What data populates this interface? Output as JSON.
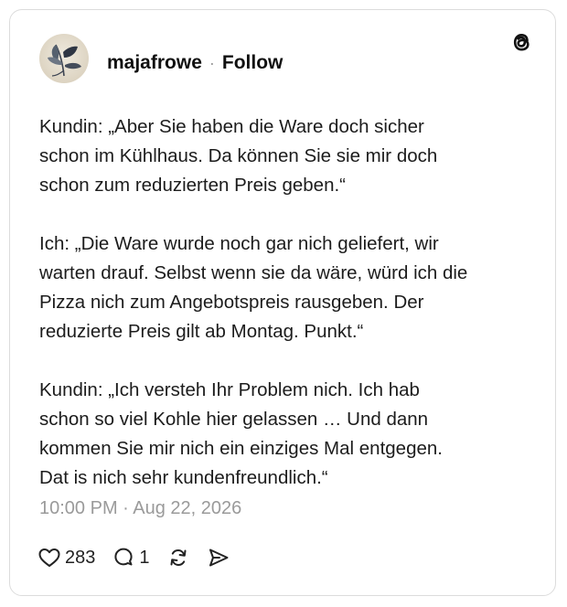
{
  "post": {
    "username": "majafrowe",
    "separator": "·",
    "follow_label": "Follow",
    "paragraphs": [
      "Kundin: „Aber Sie haben die Ware doch sicher\nschon im Kühlhaus. Da können Sie sie mir doch\nschon zum reduzierten Preis geben.“",
      "Ich: „Die Ware wurde noch gar nich geliefert, wir\nwarten drauf. Selbst wenn sie da wäre, würd ich die\nPizza nich zum Angebotspreis rausgeben. Der\nreduzierte Preis gilt ab Montag. Punkt.“",
      "Kundin: „Ich versteh Ihr Problem nich. Ich hab\nschon so viel Kohle hier gelassen … Und dann\nkommen Sie mir nich ein einziges Mal entgegen.\nDat is nich sehr kundenfreundlich.“"
    ],
    "timestamp": "10:00 PM · Aug 22, 2026",
    "likes": "283",
    "replies": "1"
  },
  "icons": {
    "brand": "threads-logo-icon",
    "like": "heart-icon",
    "reply": "speech-bubble-icon",
    "repost": "repost-icon",
    "share": "send-icon"
  }
}
